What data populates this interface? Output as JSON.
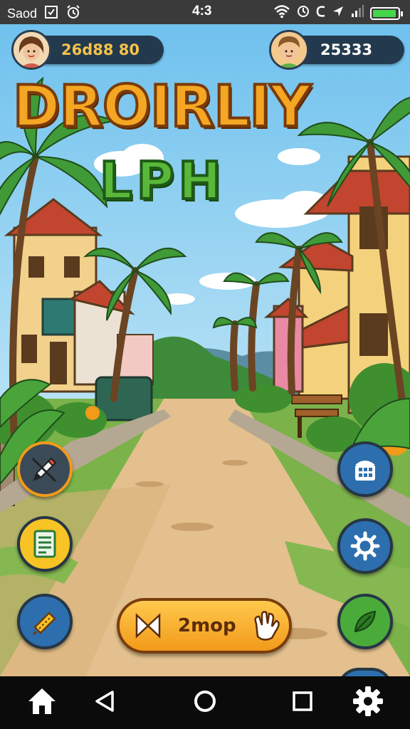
{
  "status_bar": {
    "left_text": "Saod",
    "time": "4:3"
  },
  "players": {
    "player1": {
      "score": "26d88 80"
    },
    "player2": {
      "score": "25333"
    }
  },
  "title": {
    "line1": "DROIRLIY",
    "line2": "LPH"
  },
  "play_button": {
    "label": "2mop"
  },
  "colors": {
    "sky": "#7cc7ee",
    "title_orange": "#f5a623",
    "title_green": "#59b83a",
    "pill_navy": "#23394d",
    "button_orange": "#f5a623",
    "battery_green": "#46d64b"
  },
  "icons": {
    "left_buttons": [
      "pencil-icon",
      "document-icon",
      "ticket-icon"
    ],
    "right_buttons": [
      "shop-icon",
      "settings-icon",
      "leaf-icon"
    ],
    "nav": [
      "home-icon",
      "back-icon",
      "circle-home-icon",
      "recents-icon",
      "gear-icon"
    ]
  }
}
